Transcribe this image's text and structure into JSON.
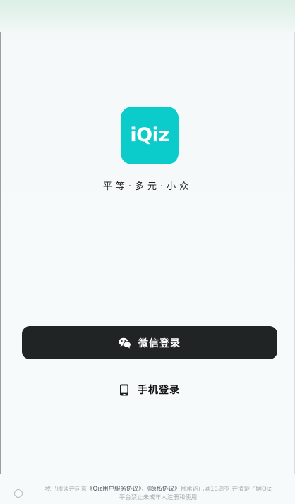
{
  "brand": {
    "logo_text": "iQiz",
    "accent_color": "#0ccbcb",
    "tagline": "平等·多元·小众"
  },
  "login": {
    "wechat_label": "微信登录",
    "wechat_icon": "wechat-icon",
    "phone_label": "手机登录",
    "phone_icon": "phone-icon"
  },
  "agreement": {
    "prefix": "我已阅读并同意",
    "user_agreement": "《Qiz用户服务协议》",
    "separator": "、",
    "privacy_policy": "《隐私协议》",
    "suffix": "且承诺已满18周岁,并清楚了解Qiz",
    "line2": "平台禁止未成年人注册和使用"
  }
}
